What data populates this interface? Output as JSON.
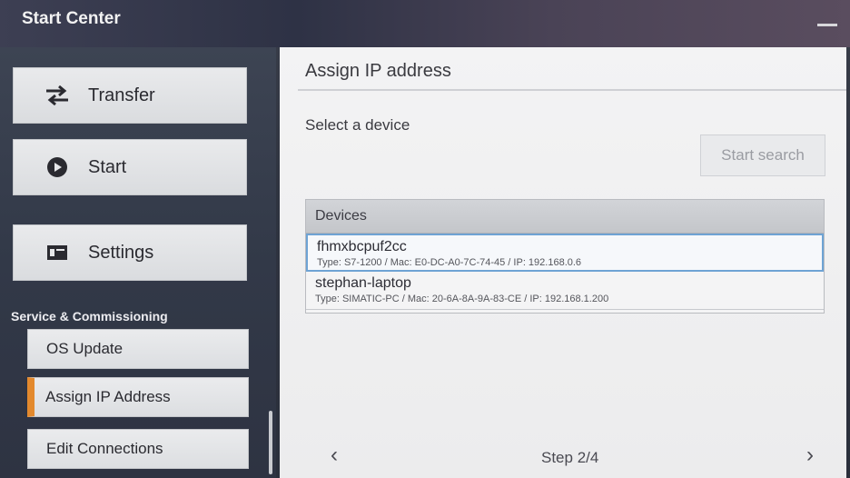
{
  "window": {
    "title": "Start Center"
  },
  "sidebar": {
    "buttons": [
      {
        "label": "Transfer",
        "icon": "transfer-arrows-icon"
      },
      {
        "label": "Start",
        "icon": "play-circle-icon"
      },
      {
        "label": "Settings",
        "icon": "settings-panel-icon"
      }
    ],
    "section_label": "Service & Commissioning",
    "sub_items": [
      {
        "label": "OS Update",
        "active": false
      },
      {
        "label": "Assign IP Address",
        "active": true
      },
      {
        "label": "Edit Connections",
        "active": false
      }
    ]
  },
  "panel": {
    "title": "Assign IP address",
    "select_label": "Select a device",
    "search_button": "Start search",
    "devices_header": "Devices",
    "devices": [
      {
        "name": "fhmxbcpuf2cc",
        "info": "Type: S7-1200 / Mac: E0-DC-A0-7C-74-45 / IP: 192.168.0.6",
        "selected": true
      },
      {
        "name": "stephan-laptop",
        "info": "Type: SIMATIC-PC / Mac: 20-6A-8A-9A-83-CE / IP: 192.168.1.200",
        "selected": false
      }
    ],
    "step": "Step 2/4",
    "prev": "‹",
    "next": "›"
  },
  "colors": {
    "accent": "#e3892d",
    "selection": "#6ea3d4"
  }
}
